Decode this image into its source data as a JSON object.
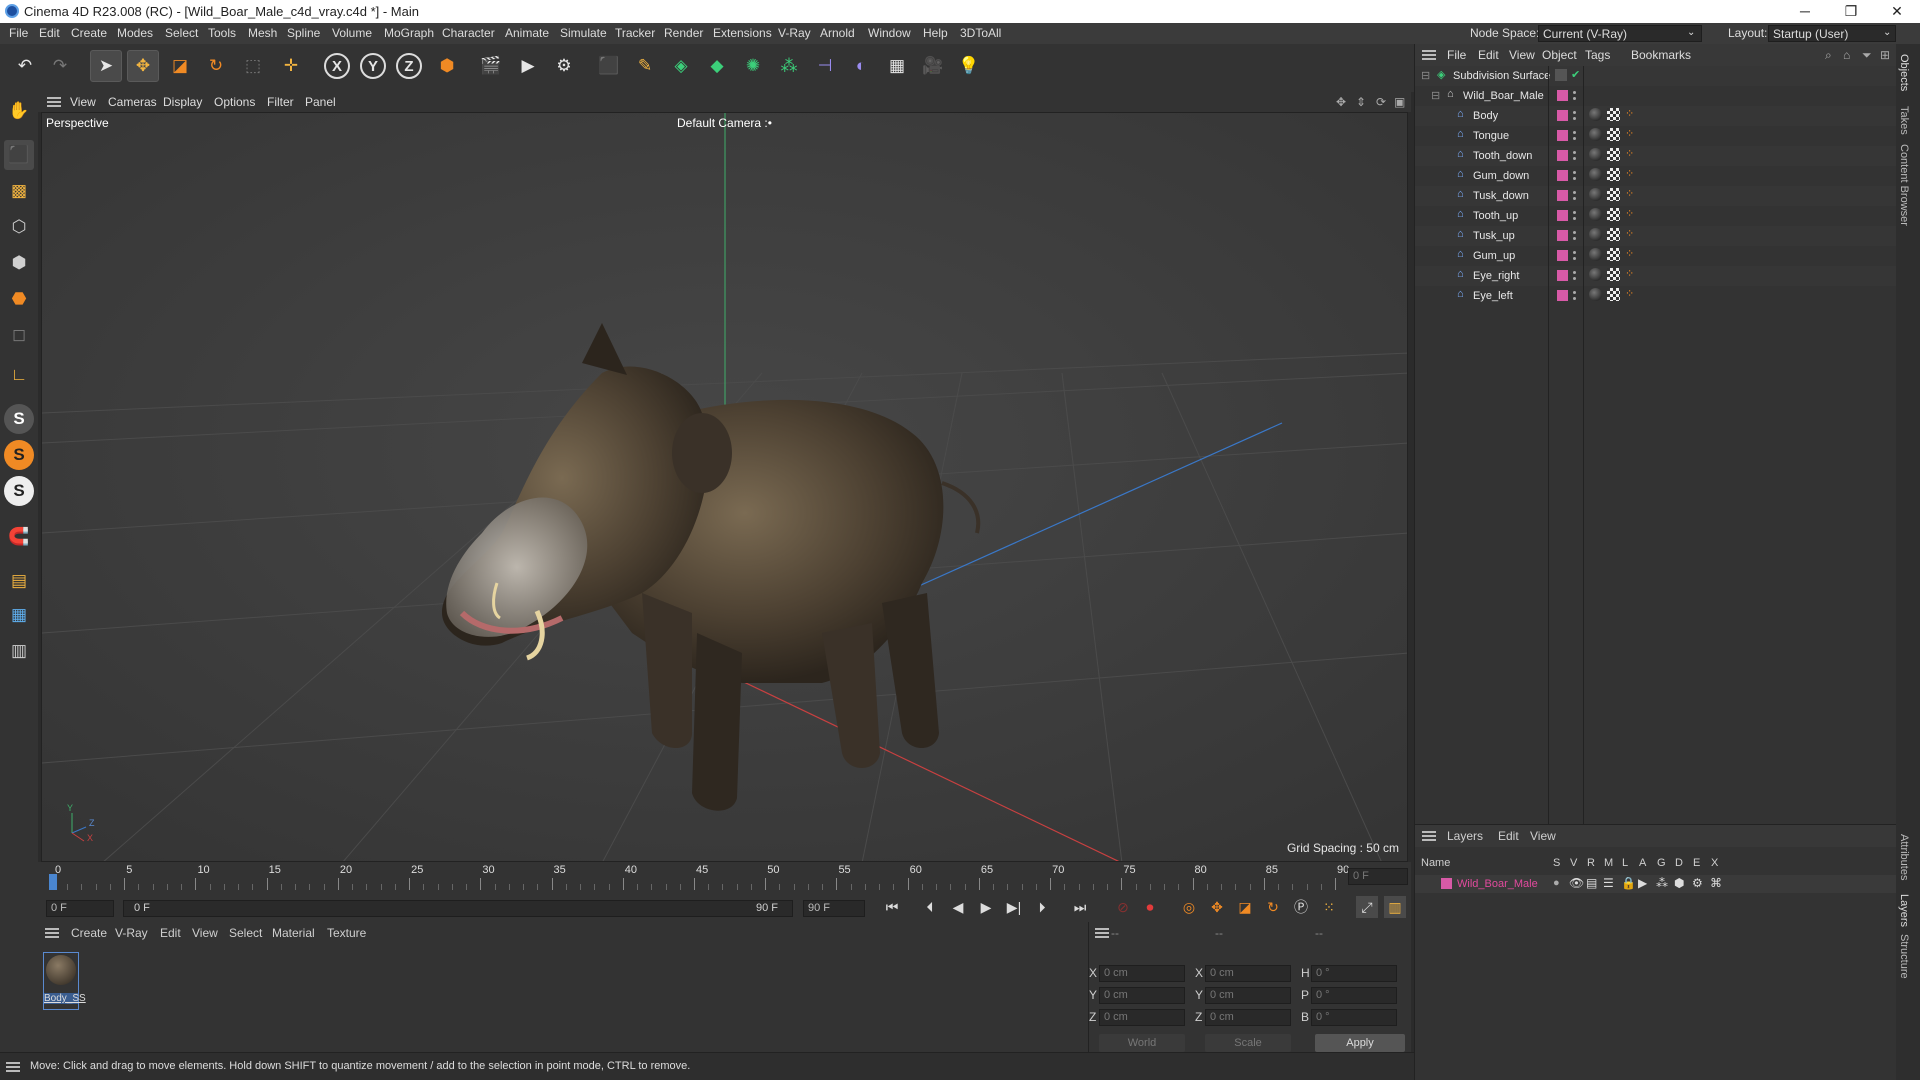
{
  "title_bar": {
    "text": "Cinema 4D R23.008 (RC) - [Wild_Boar_Male_c4d_vray.c4d *] - Main",
    "minimize": "─",
    "maximize": "❐",
    "close": "✕"
  },
  "menu": {
    "items": [
      "File",
      "Edit",
      "Create",
      "Modes",
      "Select",
      "Tools",
      "Mesh",
      "Spline",
      "Volume",
      "MoGraph",
      "Character",
      "Animate",
      "Simulate",
      "Tracker",
      "Render",
      "Extensions",
      "V-Ray",
      "Arnold",
      "Window",
      "Help",
      "3DToAll"
    ],
    "node_space_label": "Node Space:",
    "node_space_value": "Current (V-Ray)",
    "layout_label": "Layout:",
    "layout_value": "Startup (User)"
  },
  "viewport_menu": [
    "View",
    "Cameras",
    "Display",
    "Options",
    "Filter",
    "Panel"
  ],
  "viewport": {
    "label": "Perspective",
    "camera": "Default Camera",
    "grid_spacing": "Grid Spacing : 50 cm",
    "axis_x": "X",
    "axis_y": "Y",
    "axis_z": "Z"
  },
  "object_panel": {
    "menu": [
      "File",
      "Edit",
      "View",
      "Object",
      "Tags",
      "Bookmarks"
    ],
    "root": "Subdivision Surface",
    "group": "Wild_Boar_Male",
    "objects": [
      "Body",
      "Tongue",
      "Tooth_down",
      "Gum_down",
      "Tusk_down",
      "Tooth_up",
      "Tusk_up",
      "Gum_up",
      "Eye_right",
      "Eye_left"
    ]
  },
  "layers_panel": {
    "menu": [
      "Layers",
      "Edit",
      "View"
    ],
    "columns": [
      "Name",
      "S",
      "V",
      "R",
      "M",
      "L",
      "A",
      "G",
      "D",
      "E",
      "X"
    ],
    "layer": "Wild_Boar_Male"
  },
  "right_tabs": [
    "Objects",
    "Takes",
    "Content Browser",
    "Attributes",
    "Layers",
    "Structure"
  ],
  "timeline": {
    "ticks": [
      "0",
      "5",
      "10",
      "15",
      "20",
      "25",
      "30",
      "35",
      "40",
      "45",
      "50",
      "55",
      "60",
      "65",
      "70",
      "75",
      "80",
      "85",
      "90"
    ],
    "current_frame_right": "0 F",
    "start_field": "0 F",
    "range_start": "0 F",
    "range_end": "90 F",
    "end_field": "90 F"
  },
  "material_panel": {
    "menu": [
      "Create",
      "V-Ray",
      "Edit",
      "View",
      "Select",
      "Material",
      "Texture"
    ],
    "material_name": "Body_SS"
  },
  "coords": {
    "header": [
      "--",
      "--",
      "--"
    ],
    "rows": [
      {
        "a": "X",
        "av": "0 cm",
        "b": "X",
        "bv": "0 cm",
        "c": "H",
        "cv": "0 °"
      },
      {
        "a": "Y",
        "av": "0 cm",
        "b": "Y",
        "bv": "0 cm",
        "c": "P",
        "cv": "0 °"
      },
      {
        "a": "Z",
        "av": "0 cm",
        "b": "Z",
        "bv": "0 cm",
        "c": "B",
        "cv": "0 °"
      }
    ],
    "world": "World",
    "scale": "Scale",
    "apply": "Apply"
  },
  "status": "Move: Click and drag to move elements. Hold down SHIFT to quantize movement / add to the selection in point mode, CTRL to remove."
}
